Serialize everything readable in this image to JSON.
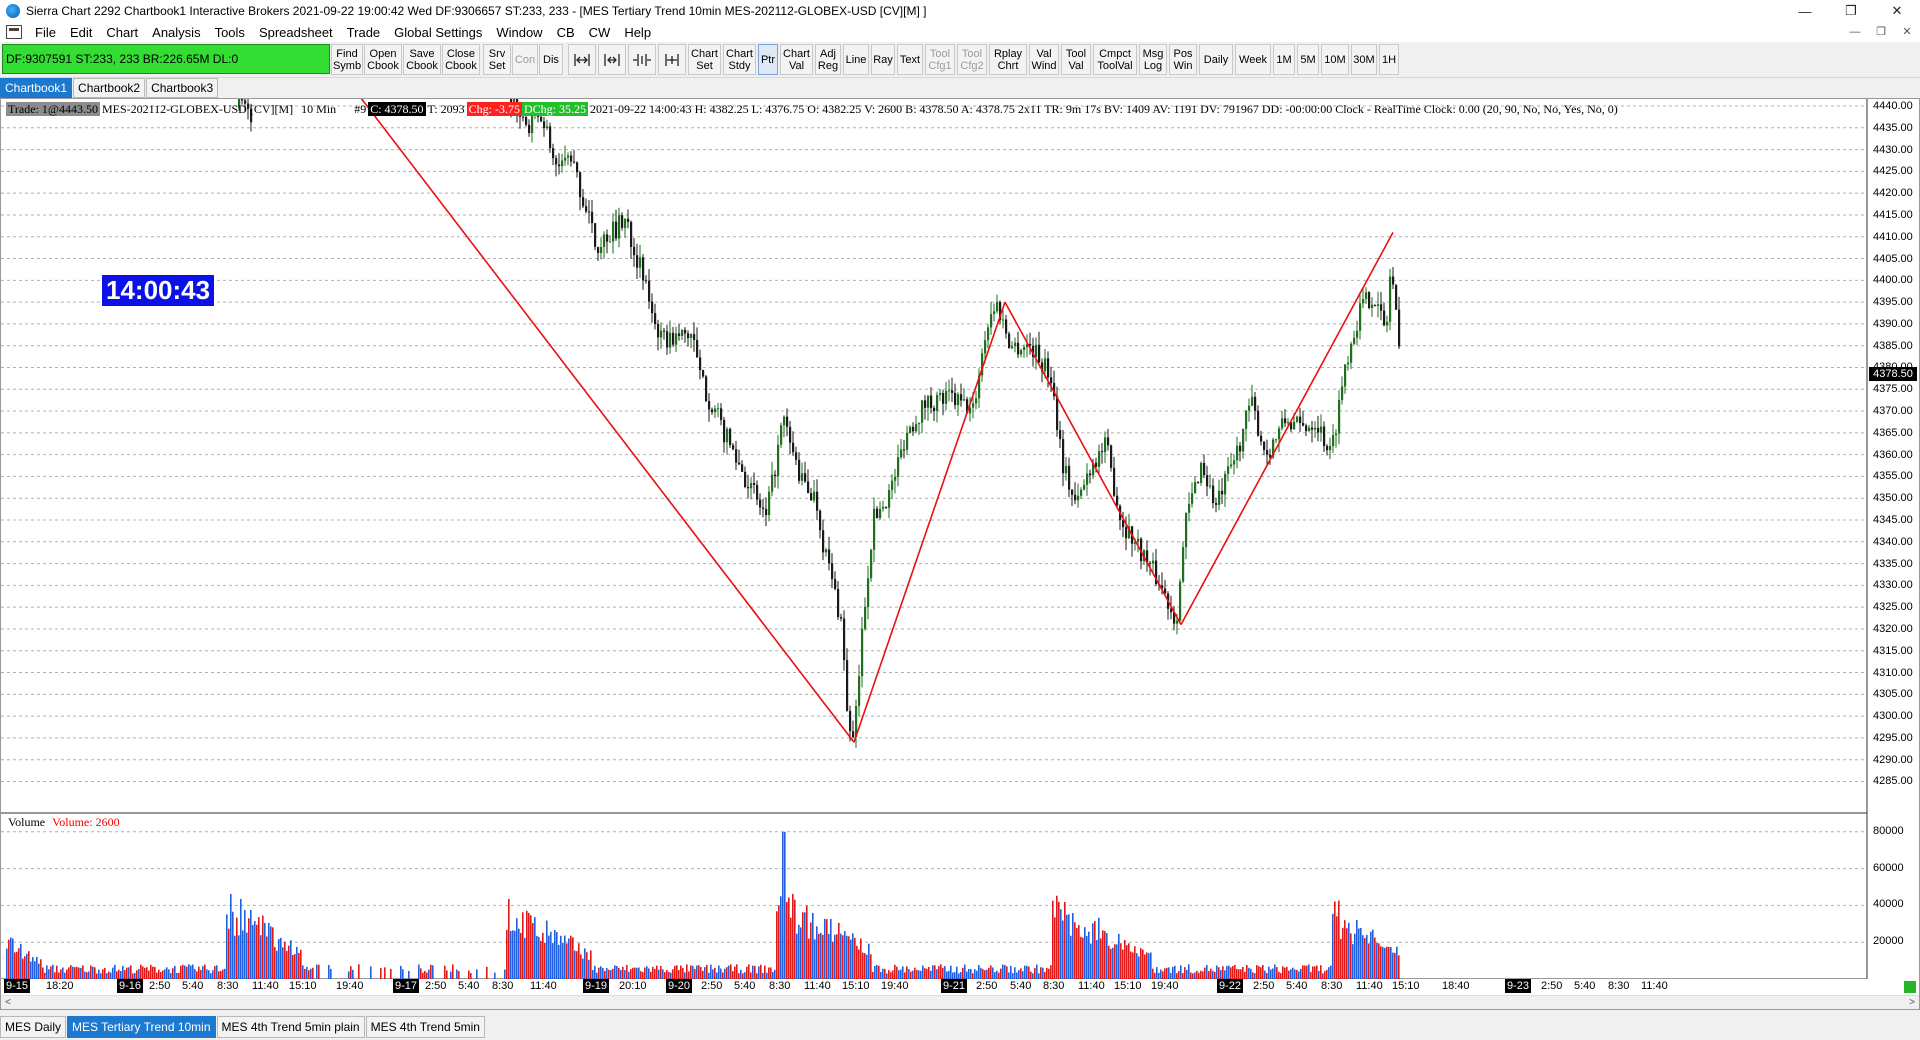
{
  "window": {
    "title": "Sierra Chart 2292 Chartbook1  Interactive Brokers 2021-09-22  19:00:42 Wed  DF:9306657  ST:233, 233 - [MES Tertiary Trend 10min MES-202112-GLOBEX-USD [CV][M] ]",
    "minimize": "—",
    "maximize": "❐",
    "close": "✕"
  },
  "menu": {
    "items": [
      "File",
      "Edit",
      "Chart",
      "Analysis",
      "Tools",
      "Spreadsheet",
      "Trade",
      "Global Settings",
      "Window",
      "CB",
      "CW",
      "Help"
    ],
    "mdi": [
      "—",
      "❐",
      "✕"
    ]
  },
  "toolbar": {
    "status": "DF:9307591  ST:233, 233  BR:226.65M  DL:0",
    "buttons": [
      {
        "label": "Find\nSymb",
        "disabled": false
      },
      {
        "label": "Open\nCbook",
        "disabled": false
      },
      {
        "label": "Save\nCbook",
        "disabled": false
      },
      {
        "label": "Close\nCbook",
        "disabled": false
      },
      {
        "label": "Srv\nSet",
        "disabled": false
      },
      {
        "label": "Con",
        "disabled": true
      },
      {
        "label": "Dis",
        "disabled": false
      },
      {
        "label": "",
        "icon": "zoom-range-icon"
      },
      {
        "label": "",
        "icon": "expand-range-icon"
      },
      {
        "label": "",
        "icon": "compress-bars-icon"
      },
      {
        "label": "",
        "icon": "expand-bars-icon"
      },
      {
        "label": "Chart\nSet",
        "disabled": false
      },
      {
        "label": "Chart\nStdy",
        "disabled": false
      },
      {
        "label": "Ptr",
        "disabled": false,
        "active": true
      },
      {
        "label": "Chart\nVal",
        "disabled": false
      },
      {
        "label": "Adj\nReg",
        "disabled": false
      },
      {
        "label": "Line",
        "disabled": false
      },
      {
        "label": "Ray",
        "disabled": false
      },
      {
        "label": "Text",
        "disabled": false
      },
      {
        "label": "Tool\nCfg1",
        "disabled": true
      },
      {
        "label": "Tool\nCfg2",
        "disabled": true
      },
      {
        "label": "Rplay\nChrt",
        "disabled": false
      },
      {
        "label": "Val\nWind",
        "disabled": false
      },
      {
        "label": "Tool\nVal",
        "disabled": false
      },
      {
        "label": "Cmpct\nToolVal",
        "disabled": false
      },
      {
        "label": "Msg\nLog",
        "disabled": false
      },
      {
        "label": "Pos\nWin",
        "disabled": false
      },
      {
        "label": "Daily",
        "disabled": false
      },
      {
        "label": "Week",
        "disabled": false
      },
      {
        "label": "1M",
        "disabled": false
      },
      {
        "label": "5M",
        "disabled": false
      },
      {
        "label": "10M",
        "disabled": false
      },
      {
        "label": "30M",
        "disabled": false
      },
      {
        "label": "1H",
        "disabled": false
      }
    ]
  },
  "chartbooks": [
    "Chartbook1",
    "Chartbook2",
    "Chartbook3"
  ],
  "chart": {
    "info": {
      "trade": "Trade: 1@4443.50",
      "symbol": "MES-202112-GLOBEX-USD [CV][M]",
      "interval": "10 Min",
      "num": "#9",
      "close": "C: 4378.50",
      "ticks": "T: 2093",
      "chg": "Chg: -3.75",
      "dchg": "DChg: 35.25",
      "details": "2021-09-22 14:00:43 H: 4382.25 L: 4376.75 O: 4382.25 V: 2600 B: 4378.50 A: 4378.75 2x11 TR: 9m 17s BV: 1409 AV: 1191 DV: 791967 DD: -00:00:00 Clock - RealTime  Clock: 0.00  (20, 90, No, No, Yes, No, 0)"
    },
    "clock": "14:00:43",
    "current_price": "4378.50",
    "price_ticks": [
      "4440.00",
      "4435.00",
      "4430.00",
      "4425.00",
      "4420.00",
      "4415.00",
      "4410.00",
      "4405.00",
      "4400.00",
      "4395.00",
      "4390.00",
      "4385.00",
      "4380.00",
      "4375.00",
      "4370.00",
      "4365.00",
      "4360.00",
      "4355.00",
      "4350.00",
      "4345.00",
      "4340.00",
      "4335.00",
      "4330.00",
      "4325.00",
      "4320.00",
      "4315.00",
      "4310.00",
      "4305.00",
      "4300.00",
      "4295.00",
      "4290.00",
      "4285.00"
    ],
    "volume_title": "Volume",
    "volume_value": "Volume: 2600",
    "volume_ticks": [
      "80000",
      "60000",
      "40000",
      "20000"
    ],
    "time_labels": [
      {
        "text": "9-15",
        "day": true
      },
      {
        "text": "18:20",
        "day": false
      },
      {
        "text": "9-16",
        "day": true
      },
      {
        "text": "2:50",
        "day": false
      },
      {
        "text": "5:40",
        "day": false
      },
      {
        "text": "8:30",
        "day": false
      },
      {
        "text": "11:40",
        "day": false
      },
      {
        "text": "15:10",
        "day": false
      },
      {
        "text": "19:40",
        "day": false
      },
      {
        "text": "9-17",
        "day": true
      },
      {
        "text": "2:50",
        "day": false
      },
      {
        "text": "5:40",
        "day": false
      },
      {
        "text": "8:30",
        "day": false
      },
      {
        "text": "11:40",
        "day": false
      },
      {
        "text": "9-19",
        "day": true
      },
      {
        "text": "20:10",
        "day": false
      },
      {
        "text": "9-20",
        "day": true
      },
      {
        "text": "2:50",
        "day": false
      },
      {
        "text": "5:40",
        "day": false
      },
      {
        "text": "8:30",
        "day": false
      },
      {
        "text": "11:40",
        "day": false
      },
      {
        "text": "15:10",
        "day": false
      },
      {
        "text": "19:40",
        "day": false
      },
      {
        "text": "9-21",
        "day": true
      },
      {
        "text": "2:50",
        "day": false
      },
      {
        "text": "5:40",
        "day": false
      },
      {
        "text": "8:30",
        "day": false
      },
      {
        "text": "11:40",
        "day": false
      },
      {
        "text": "15:10",
        "day": false
      },
      {
        "text": "19:40",
        "day": false
      },
      {
        "text": "9-22",
        "day": true
      },
      {
        "text": "2:50",
        "day": false
      },
      {
        "text": "5:40",
        "day": false
      },
      {
        "text": "8:30",
        "day": false
      },
      {
        "text": "11:40",
        "day": false
      },
      {
        "text": "15:10",
        "day": false
      },
      {
        "text": "18:40",
        "day": false
      },
      {
        "text": "9-23",
        "day": true
      },
      {
        "text": "2:50",
        "day": false
      },
      {
        "text": "5:40",
        "day": false
      },
      {
        "text": "8:30",
        "day": false
      },
      {
        "text": "11:40",
        "day": false
      }
    ],
    "colors": {
      "trend_line": "#e81010",
      "up_bar": "#1f6f1f",
      "down_bar": "#1a1a1a",
      "vol_up": "#1f5fe0",
      "vol_down": "#e01818",
      "grid": "#b0b0b0"
    },
    "trend_pivots": [
      {
        "time": "9-16 ~19:40",
        "price": 4443
      },
      {
        "time": "9-20 ~13:30",
        "price": 4294
      },
      {
        "time": "9-21 ~05:40",
        "price": 4395
      },
      {
        "time": "9-21 ~21:00",
        "price": 4321
      },
      {
        "time": "9-22 ~12:00",
        "price": 4411
      }
    ]
  },
  "chart_tabs": [
    "MES Daily",
    "MES Tertiary Trend 10min",
    "MES 4th Trend 5min plain",
    "MES 4th Trend 5min"
  ],
  "active_chart_tab": 1
}
